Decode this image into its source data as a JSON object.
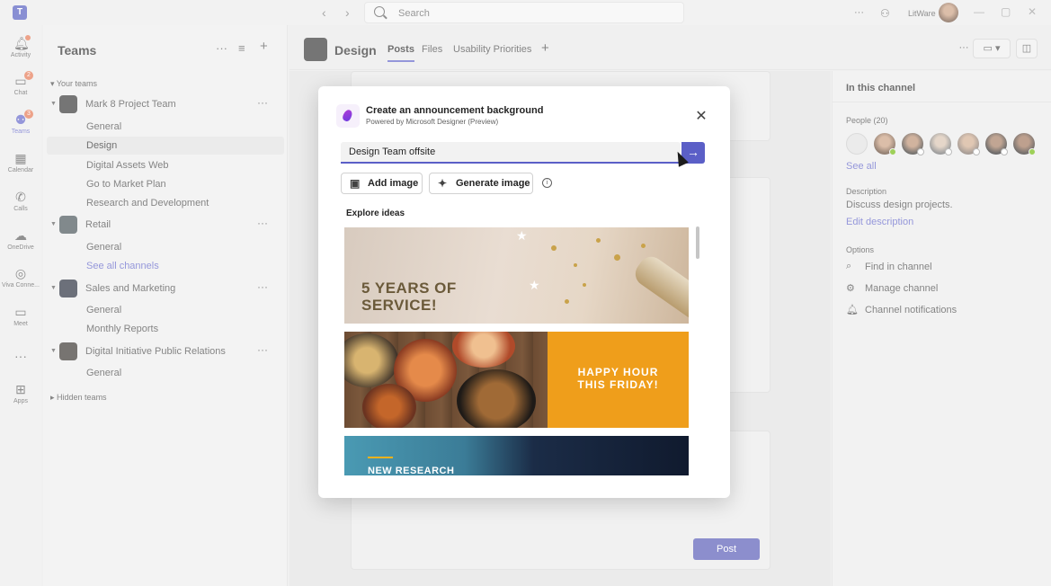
{
  "titlebar": {
    "search_placeholder": "Search",
    "org_name": "LitWare",
    "more": "···"
  },
  "rail": {
    "items": [
      {
        "label": "Activity",
        "icon": "bell-icon"
      },
      {
        "label": "Chat",
        "icon": "chat-icon",
        "badge": "2"
      },
      {
        "label": "Teams",
        "icon": "teams-icon",
        "badge": "3"
      },
      {
        "label": "Calendar",
        "icon": "calendar-icon"
      },
      {
        "label": "Calls",
        "icon": "phone-icon"
      },
      {
        "label": "OneDrive",
        "icon": "cloud-icon"
      },
      {
        "label": "Viva Conne...",
        "icon": "viva-icon"
      },
      {
        "label": "Meet",
        "icon": "camera-icon"
      },
      {
        "label": "···",
        "icon": "more-icon"
      },
      {
        "label": "Apps",
        "icon": "apps-icon"
      }
    ]
  },
  "teams_panel": {
    "title": "Teams",
    "your_teams": "Your teams",
    "hidden_teams": "Hidden teams",
    "teams": [
      {
        "name": "Mark 8 Project Team",
        "channels": [
          "General",
          "Design",
          "Digital Assets Web",
          "Go to Market Plan",
          "Research and Development"
        ]
      },
      {
        "name": "Retail",
        "channels": [
          "General"
        ],
        "see_all": "See all channels"
      },
      {
        "name": "Sales and Marketing",
        "channels": [
          "General",
          "Monthly Reports"
        ]
      },
      {
        "name": "Digital Initiative Public Relations",
        "channels": [
          "General"
        ]
      }
    ]
  },
  "channel_header": {
    "title": "Design",
    "tabs": [
      "Posts",
      "Files",
      "Usability Priorities"
    ],
    "add_tab": "+"
  },
  "feed": {
    "post_button": "Post"
  },
  "right_panel": {
    "title": "In this channel",
    "people_label": "People (20)",
    "see_all": "See all",
    "description_label": "Description",
    "description": "Discuss design projects.",
    "edit_description": "Edit description",
    "options_label": "Options",
    "options": [
      {
        "label": "Find in channel",
        "icon": "search-icon"
      },
      {
        "label": "Manage channel",
        "icon": "gear-icon"
      },
      {
        "label": "Channel notifications",
        "icon": "bell-icon"
      }
    ]
  },
  "dialog": {
    "title": "Create an announcement background",
    "subtitle": "Powered by Microsoft Designer (Preview)",
    "input_value": "Design Team offsite",
    "add_image": "Add image",
    "generate_image": "Generate image",
    "explore_label": "Explore ideas",
    "ideas": [
      {
        "text_line1": "5 YEARS OF",
        "text_line2": "SERVICE!"
      },
      {
        "text_line1": "HAPPY HOUR",
        "text_line2": "THIS FRIDAY!"
      },
      {
        "text_line1": "NEW RESEARCH"
      }
    ]
  }
}
